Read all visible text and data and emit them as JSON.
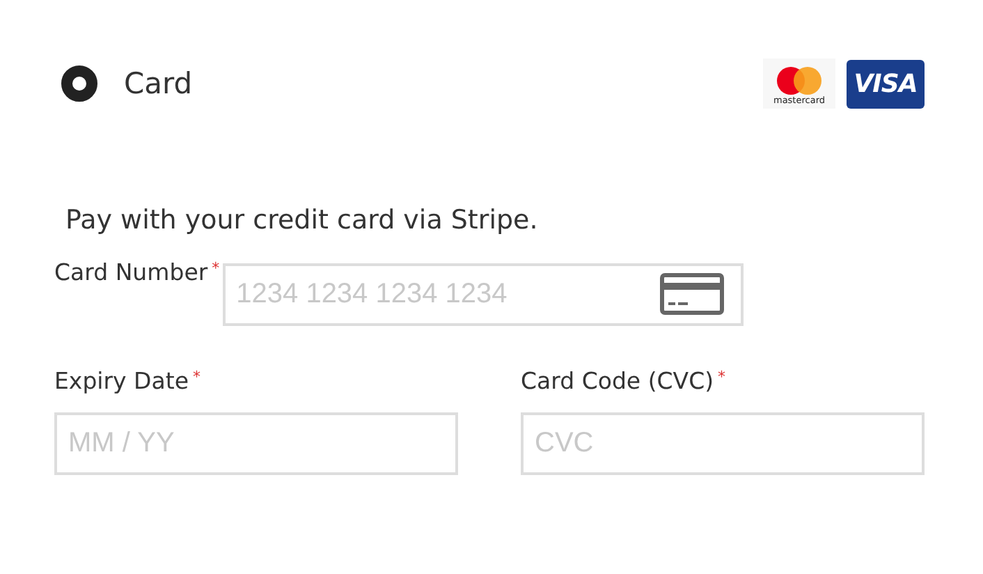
{
  "payment_method": {
    "label": "Card",
    "selected": true
  },
  "logos": [
    {
      "kind": "mastercard",
      "text": "mastercard"
    },
    {
      "kind": "visa",
      "text": "VISA"
    }
  ],
  "description": "Pay with your credit card via Stripe.",
  "fields": [
    {
      "kind": "card_number",
      "label": "Card Number",
      "required_mark": "*",
      "placeholder": "1234 1234 1234 1234"
    },
    {
      "kind": "expiry",
      "label": "Expiry Date",
      "required_mark": "*",
      "placeholder": "MM / YY"
    },
    {
      "kind": "cvc",
      "label": "Card Code (CVC)",
      "required_mark": "*",
      "placeholder": "CVC"
    }
  ]
}
